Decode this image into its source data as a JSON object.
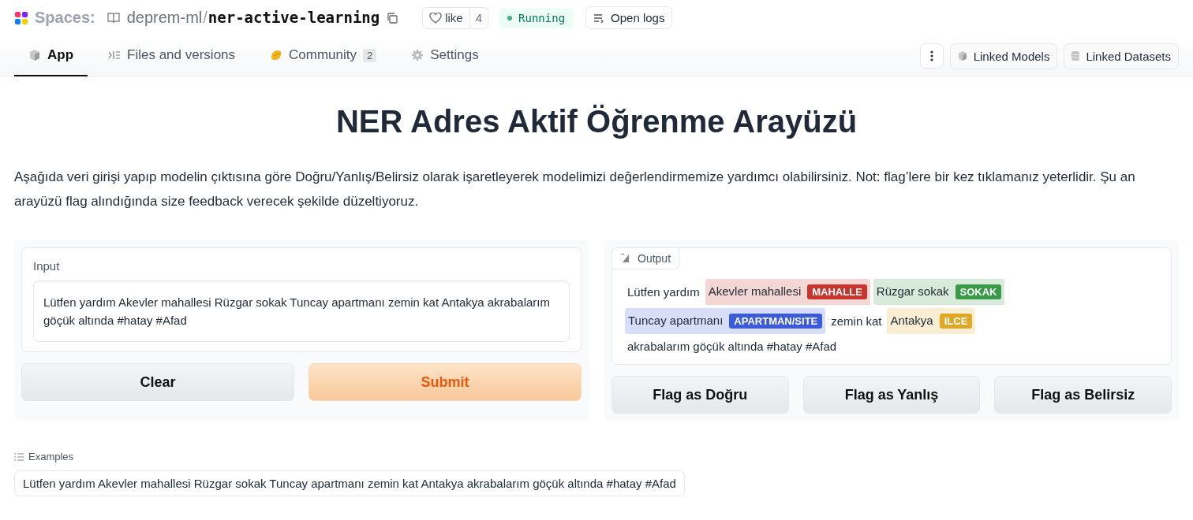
{
  "header": {
    "spaces_label": "Spaces:",
    "owner": "deprem-ml",
    "separator": "/",
    "repo": "ner-active-learning",
    "like": {
      "label": "like",
      "count": "4"
    },
    "status": {
      "label": "Running",
      "kind": "running"
    },
    "logs_button": "Open logs"
  },
  "tabs": [
    {
      "label": "App",
      "kind": "app",
      "selected": true
    },
    {
      "label": "Files and versions",
      "kind": "files",
      "selected": false
    },
    {
      "label": "Community",
      "kind": "community",
      "count": "2",
      "selected": false
    },
    {
      "label": "Settings",
      "kind": "settings",
      "selected": false
    }
  ],
  "linked_buttons": [
    {
      "label": "Linked Models",
      "kind": "models"
    },
    {
      "label": "Linked Datasets",
      "kind": "datasets"
    }
  ],
  "title": "NER Adres Aktif Öğrenme Arayüzü",
  "description": "Aşağıda veri girişi yapıp modelin çıktısına göre Doğru/Yanlış/Belirsiz olarak işaretleyerek modelimizi değerlendirmemize yardımcı olabilirsiniz. Not: flag’lere bir kez tıklamanız yeterlidir. Şu an arayüzü flag alındığında size feedback verecek şekilde düzeltiyoruz.",
  "input": {
    "label": "Input",
    "value": "Lütfen yardım Akevler mahallesi Rüzgar sokak Tuncay apartmanı zemin kat Antakya akrabalarım göçük altında #hatay #Afad"
  },
  "input_buttons": [
    {
      "label": "Clear",
      "kind": "secondary"
    },
    {
      "label": "Submit",
      "kind": "primary"
    }
  ],
  "output": {
    "label": "Output",
    "tokens": [
      {
        "text": "Lütfen yardım"
      },
      {
        "text": "Akevler mahallesi",
        "entity": "MAHALLE",
        "color": "#c9352c"
      },
      {
        "text": "Rüzgar sokak",
        "entity": "SOKAK",
        "color": "#3b9a48"
      },
      {
        "text": "Tuncay apartmanı",
        "entity": "APARTMAN/SITE",
        "color": "#3b5bdb"
      },
      {
        "text": "zemin kat"
      },
      {
        "text": "Antakya",
        "entity": "ILCE",
        "color": "#dfa826"
      },
      {
        "text": "akrabalarım göçük altında #hatay #Afad"
      }
    ]
  },
  "flag_buttons": [
    "Flag as Doğru",
    "Flag as Yanlış",
    "Flag as Belirsiz"
  ],
  "examples": {
    "label": "Examples",
    "items": [
      "Lütfen yardım Akevler mahallesi Rüzgar sokak Tuncay apartmanı zemin kat Antakya akrabalarım göçük altında #hatay #Afad"
    ]
  }
}
